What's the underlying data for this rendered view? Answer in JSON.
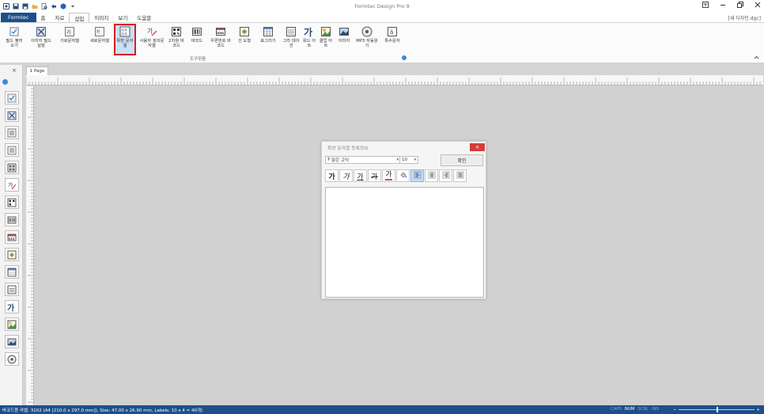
{
  "window": {
    "title": "Formtec Design Pro 9",
    "document_name": "[새 디자인.dgc]"
  },
  "menu_tabs": [
    {
      "label": "Formtec"
    },
    {
      "label": "홈"
    },
    {
      "label": "자료"
    },
    {
      "label": "삽입",
      "active": true
    },
    {
      "label": "이미지"
    },
    {
      "label": "보기"
    },
    {
      "label": "도움말"
    }
  ],
  "ribbon": {
    "group_label": "도구모음",
    "buttons": [
      {
        "label": "필드 불러오기",
        "icon": "field-load-icon"
      },
      {
        "label": "이미지 필드 설정",
        "icon": "image-field-icon"
      },
      {
        "label": "가로문자열",
        "icon": "horizontal-text-icon"
      },
      {
        "label": "세로문자열",
        "icon": "vertical-text-icon"
      },
      {
        "label": "확장 문자열",
        "icon": "extended-text-icon",
        "selected": true
      },
      {
        "label": "사용자 정의문자열",
        "icon": "custom-text-icon"
      },
      {
        "label": "2차원 바코드",
        "icon": "qr-code-icon"
      },
      {
        "label": "바코드",
        "icon": "barcode-icon"
      },
      {
        "label": "우편번호 바코드",
        "icon": "postal-barcode-icon"
      },
      {
        "label": "선 도형",
        "icon": "shape-icon"
      },
      {
        "label": "표그리기",
        "icon": "table-icon"
      },
      {
        "label": "그라 데이션",
        "icon": "gradient-icon"
      },
      {
        "label": "워드 아트",
        "icon": "word-art-icon"
      },
      {
        "label": "클립 아트",
        "icon": "clip-art-icon"
      },
      {
        "label": "이미지",
        "icon": "image-icon"
      },
      {
        "label": "MP3 자동읽기",
        "icon": "mp3-icon"
      },
      {
        "label": "특수문자",
        "icon": "special-char-icon"
      }
    ]
  },
  "left_panel": {
    "close": "×",
    "tools": [
      "check-icon",
      "image-field-icon",
      "horizontal-text-icon",
      "vertical-text-icon",
      "extended-text-icon",
      "custom-text-icon",
      "qr-code-icon",
      "barcode-icon",
      "postal-barcode-icon",
      "shape-icon",
      "table-icon",
      "gradient-icon",
      "word-art-icon",
      "clip-art-icon",
      "image-icon",
      "mp3-icon"
    ]
  },
  "document": {
    "tab_label": "1 Page"
  },
  "dialog": {
    "title": "확장 문자열 등록정보",
    "close": "×",
    "font_name": "맑은 고딕",
    "font_size": "10",
    "ok_label": "확인",
    "format_glyph": "가"
  },
  "status": {
    "info": "바코드용 라벨: 3102 (A4 [210.0 x 297.0 mm]), Size: 47.00 x 26.90 mm,  Labels: 10 x 4 = 40개)",
    "indicators": [
      {
        "label": "CAPS",
        "on": false
      },
      {
        "label": "NUM",
        "on": true
      },
      {
        "label": "SCRL",
        "on": false
      },
      {
        "label": "INS",
        "on": false
      }
    ],
    "zoom_minus": "−",
    "zoom_plus": "+",
    "zoom_level": 0.5
  }
}
